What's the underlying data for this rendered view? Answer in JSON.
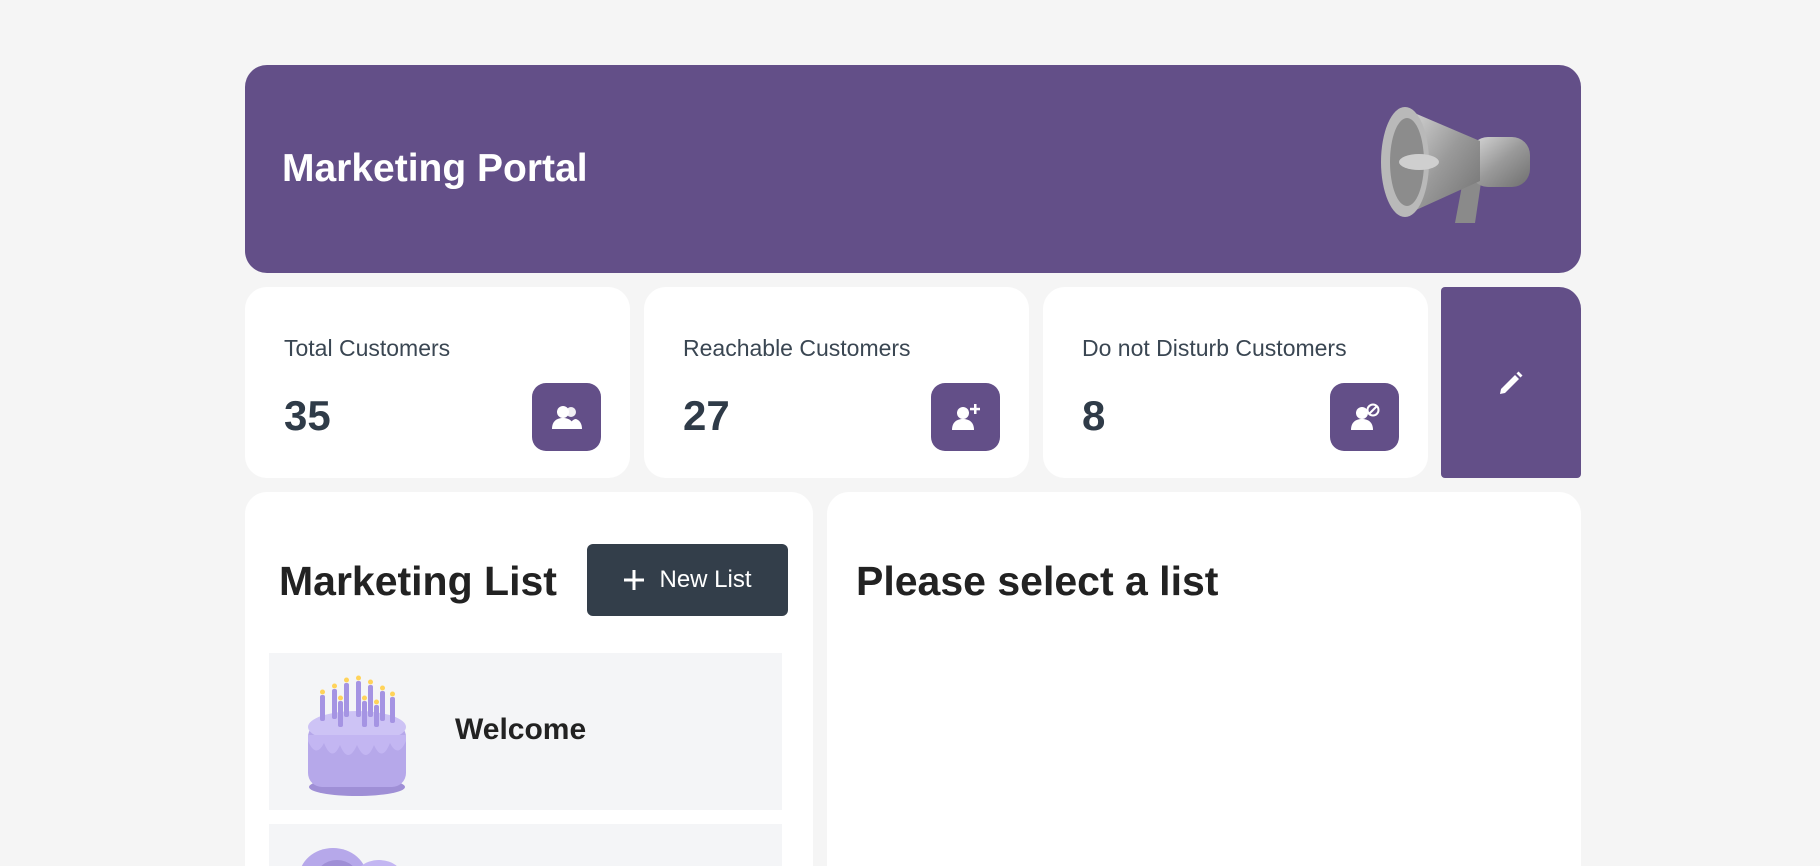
{
  "header": {
    "title": "Marketing Portal",
    "icon": "megaphone-icon",
    "background": "#634f88"
  },
  "stats": [
    {
      "label": "Total Customers",
      "value": "35",
      "icon": "customers-icon"
    },
    {
      "label": "Reachable Customers",
      "value": "27",
      "icon": "add-customer-icon"
    },
    {
      "label": "Do not Disturb Customers",
      "value": "8",
      "icon": "blocked-customer-icon"
    }
  ],
  "edit_tile": {
    "icon": "pencil-icon"
  },
  "marketing_list": {
    "title": "Marketing List",
    "new_button_label": "New List",
    "items": [
      {
        "label": "Welcome",
        "icon": "birthday-cake-icon"
      },
      {
        "label": "",
        "icon": "list-art-icon"
      }
    ]
  },
  "detail_panel": {
    "title": "Please select a list"
  },
  "colors": {
    "accent": "#634f88",
    "button_dark": "#333e4a",
    "background": "#f5f5f5",
    "list_item_bg": "#f4f5f7"
  }
}
